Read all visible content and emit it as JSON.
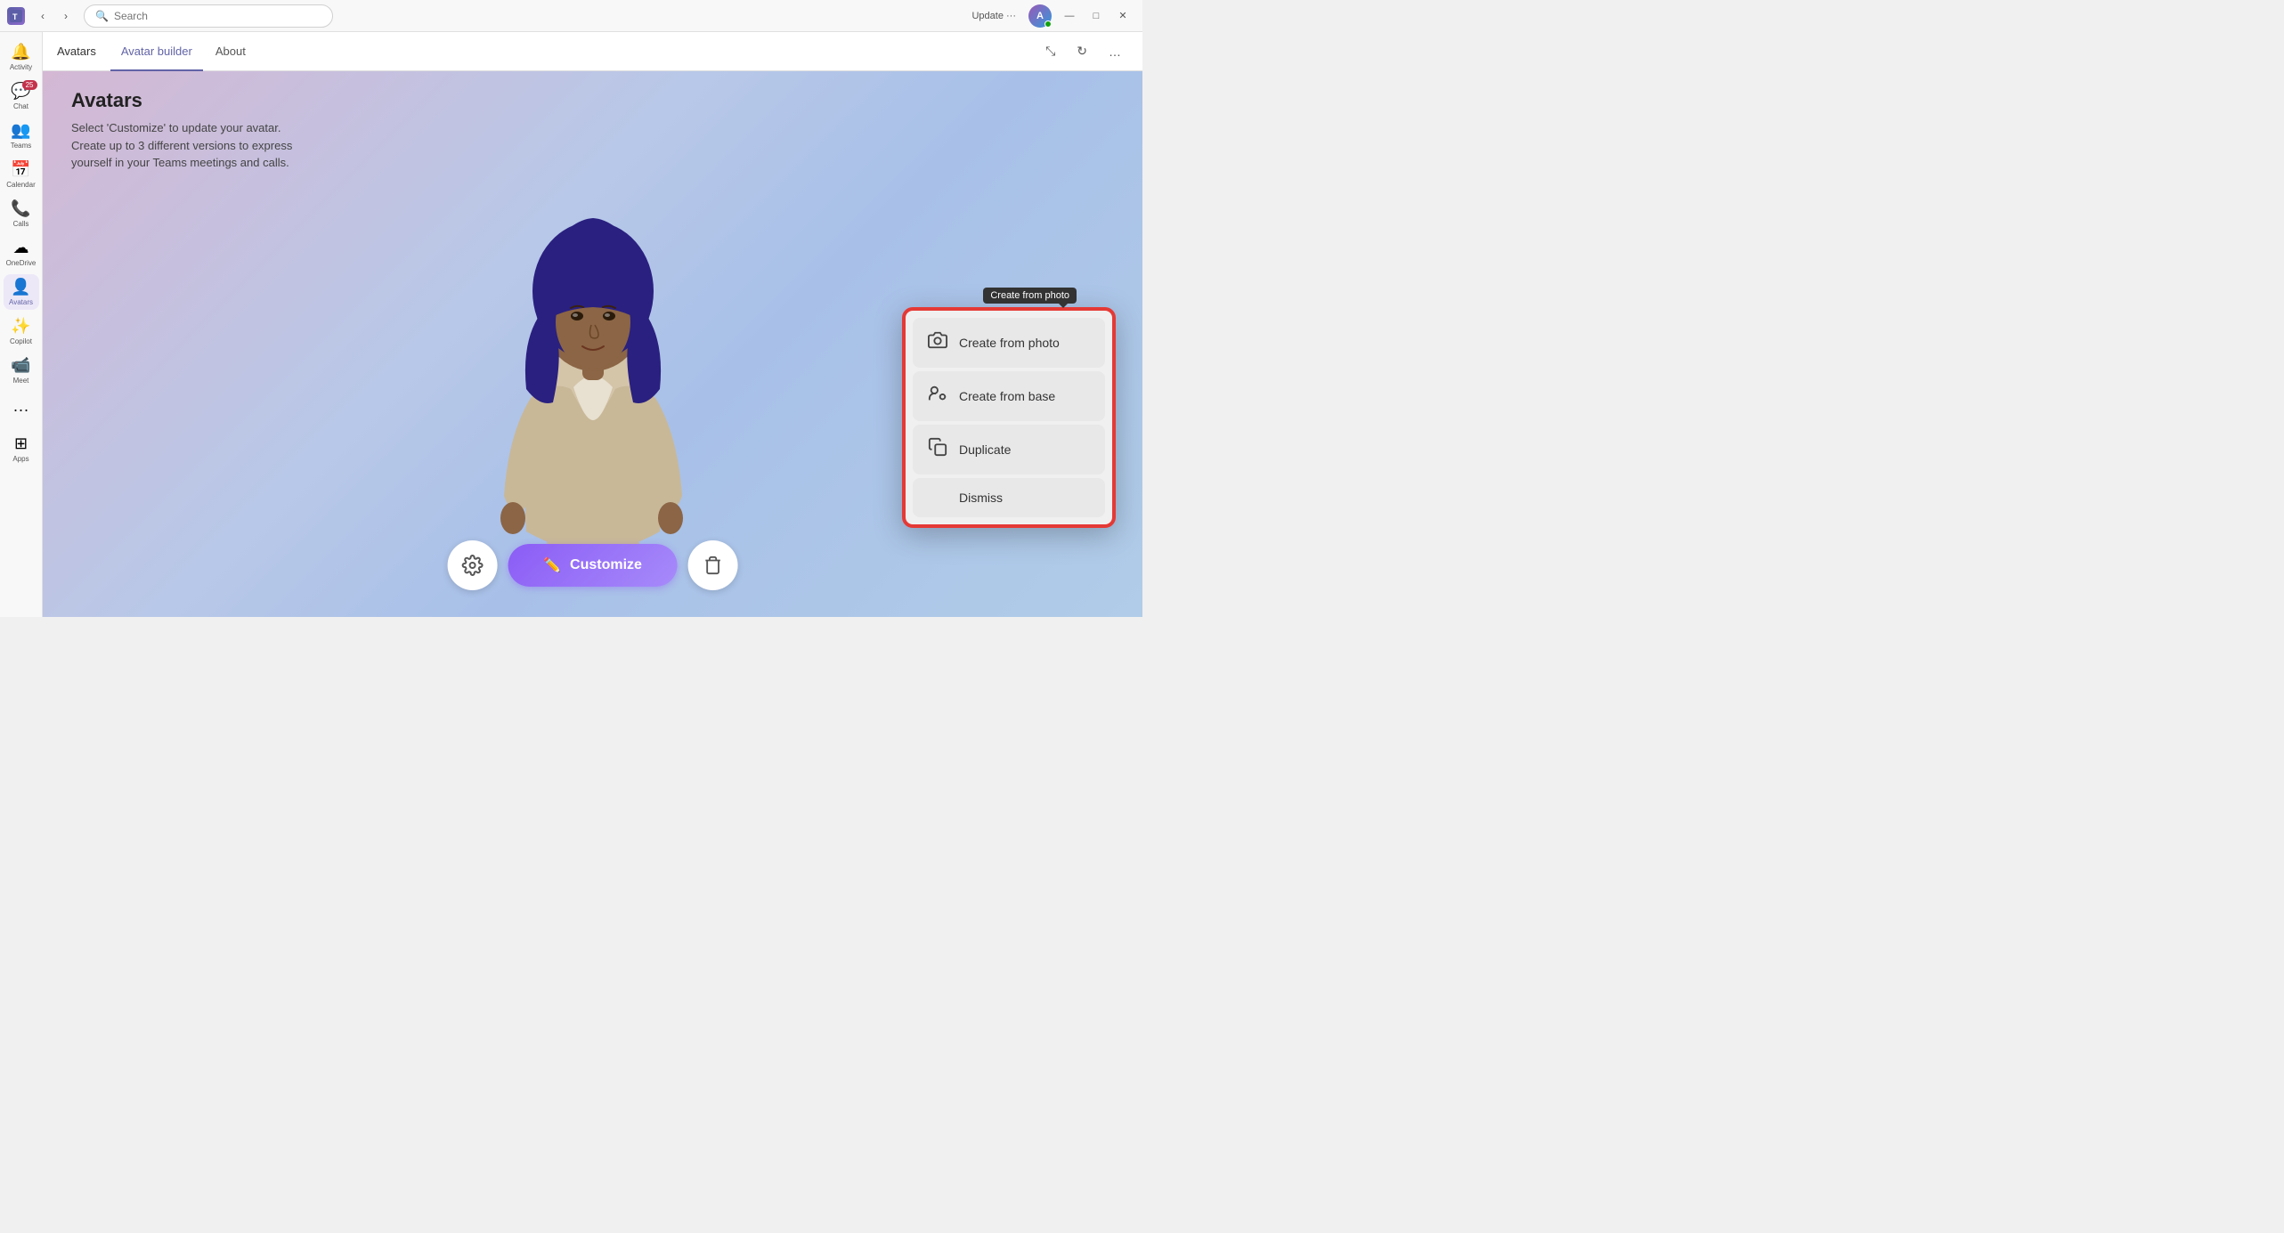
{
  "titlebar": {
    "update_label": "Update ···",
    "search_placeholder": "Search"
  },
  "sidebar": {
    "items": [
      {
        "id": "activity",
        "label": "Activity",
        "icon": "🔔",
        "badge": ""
      },
      {
        "id": "chat",
        "label": "Chat",
        "icon": "💬",
        "badge": "25"
      },
      {
        "id": "teams",
        "label": "Teams",
        "icon": "👥",
        "badge": ""
      },
      {
        "id": "calendar",
        "label": "Calendar",
        "icon": "📅",
        "badge": ""
      },
      {
        "id": "calls",
        "label": "Calls",
        "icon": "📞",
        "badge": ""
      },
      {
        "id": "onedrive",
        "label": "OneDrive",
        "icon": "☁",
        "badge": ""
      },
      {
        "id": "avatars",
        "label": "Avatars",
        "icon": "👤",
        "badge": "",
        "active": true
      },
      {
        "id": "copilot",
        "label": "Copilot",
        "icon": "✨",
        "badge": ""
      },
      {
        "id": "meet",
        "label": "Meet",
        "icon": "📹",
        "badge": ""
      },
      {
        "id": "apps",
        "label": "Apps",
        "icon": "⊞",
        "badge": ""
      }
    ]
  },
  "appheader": {
    "app_name": "Avatars",
    "tabs": [
      {
        "id": "avatar-builder",
        "label": "Avatar builder",
        "active": true
      },
      {
        "id": "about",
        "label": "About",
        "active": false
      }
    ]
  },
  "main": {
    "title": "Avatars",
    "description_line1": "Select 'Customize' to update your avatar.",
    "description_line2": "Create up to 3 different versions to express",
    "description_line3": "yourself in your Teams meetings and calls."
  },
  "bottom_controls": {
    "settings_icon": "⚙",
    "customize_label": "Customize",
    "customize_icon": "✏",
    "delete_icon": "🗑"
  },
  "popup_menu": {
    "tooltip": "Create from photo",
    "items": [
      {
        "id": "create-from-photo",
        "label": "Create from photo",
        "icon": "📷"
      },
      {
        "id": "create-from-base",
        "label": "Create from base",
        "icon": "👥"
      },
      {
        "id": "duplicate",
        "label": "Duplicate",
        "icon": "📋"
      },
      {
        "id": "dismiss",
        "label": "Dismiss",
        "icon": ""
      }
    ]
  },
  "window_controls": {
    "minimize": "—",
    "maximize": "□",
    "close": "✕"
  }
}
